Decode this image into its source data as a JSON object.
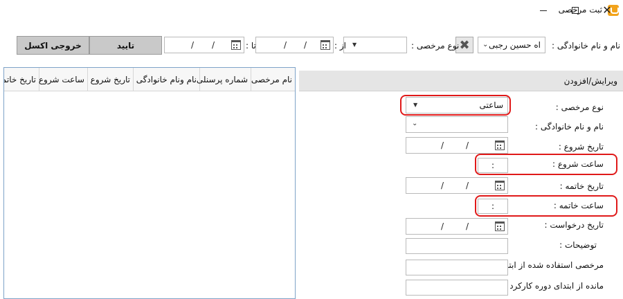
{
  "window": {
    "title": "ثبت مرخصی",
    "controls": {
      "minimize": "—",
      "maximize": "☐",
      "close": "✕"
    }
  },
  "filters": {
    "name_label": "نام و نام خانوادگی :",
    "name_value": "اه حسین رجبی",
    "leave_type_label": "نوع مرخصی :",
    "from_label": "از :",
    "from_date": [
      "/",
      "/"
    ],
    "to_label": "تا :",
    "to_date": [
      "/",
      "/"
    ],
    "confirm_label": "تایید",
    "export_label": "خروجی اکسل"
  },
  "grid": {
    "columns": [
      "نام مرخصی",
      "شماره پرسنلی",
      "نام ونام خانوادگی",
      "تاریخ شروع",
      "ساعت شروع",
      "تاریخ خاتمه"
    ]
  },
  "form": {
    "title": "ویرایش/افزودن",
    "leave_type_label": "نوع مرخصی :",
    "leave_type_value": "ساعتی",
    "name_label": "نام و نام خانوادگی :",
    "start_date_label": "تاریخ شروع :",
    "start_time_label": "ساعت شروع :",
    "start_time_value": ":",
    "end_date_label": "تاریخ خاتمه :",
    "end_time_label": "ساعت خاتمه :",
    "end_time_value": ":",
    "request_date_label": "تاریخ درخواست :",
    "description_label": "توضیحات :",
    "used_leave_label": "مرخصی استفاده شده از ابتدا :",
    "remaining_label": "مانده از ابتدای دوره کارکرد :",
    "date_sep": "/"
  },
  "colors": {
    "highlight": "#e01919",
    "button_gray": "#c9c9c9",
    "panel_header": "#e5e5e5",
    "grid_border": "#7ea3c8"
  }
}
